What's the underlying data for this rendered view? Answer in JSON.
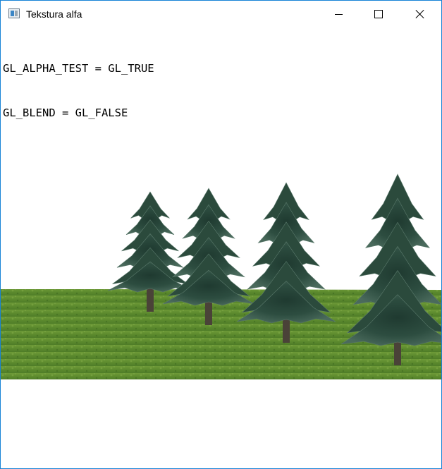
{
  "window": {
    "title": "Tekstura alfa",
    "icons": {
      "app": "app-window-icon",
      "minimize": "minimize-icon",
      "maximize": "maximize-icon",
      "close": "close-icon"
    }
  },
  "gl": {
    "lines": [
      "GL_ALPHA_TEST = GL_TRUE",
      "GL_BLEND = GL_FALSE"
    ]
  },
  "scene": {
    "sky_color": "#ffffff",
    "ground_color": "#5f8a2f",
    "tree_foliage_color": "#2b4a3c",
    "tree_trunk_color": "#4a4238",
    "tree_count": 4
  }
}
